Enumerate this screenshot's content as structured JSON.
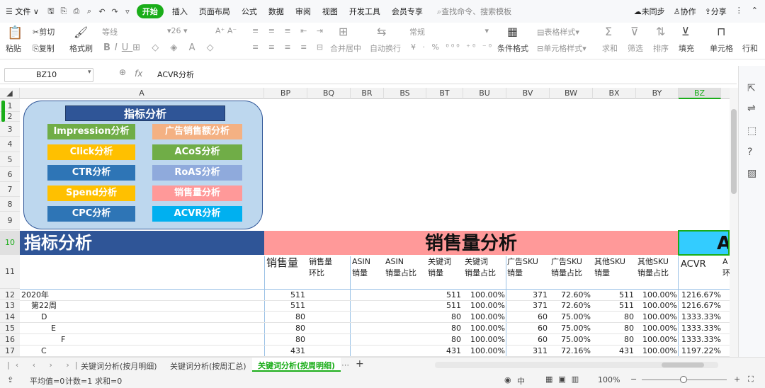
{
  "menu": {
    "file": "文件",
    "start": "开始",
    "items": [
      "插入",
      "页面布局",
      "公式",
      "数据",
      "审阅",
      "视图",
      "开发工具",
      "会员专享"
    ],
    "search": "查找命令、搜索模板",
    "unsync": "未同步",
    "collab": "协作",
    "share": "分享"
  },
  "ribbon": {
    "paste": "粘贴",
    "cut": "剪切",
    "copy": "复制",
    "format_painter": "格式刷",
    "font": "等线",
    "size": "26",
    "merge": "合并居中",
    "wrap": "自动换行",
    "numfmt": "常规",
    "cond_fmt": "条件格式",
    "table_style": "表格样式",
    "cell_style": "单元格样式",
    "sum": "求和",
    "filter": "筛选",
    "sort": "排序",
    "fill": "填充",
    "cell": "单元格",
    "rowcol": "行和"
  },
  "formula_bar": {
    "name_box": "BZ10",
    "fx": "fx",
    "content": "ACVR分析"
  },
  "columns": [
    "A",
    "BP",
    "BQ",
    "BR",
    "BS",
    "BT",
    "BU",
    "BV",
    "BW",
    "BX",
    "BY",
    "BZ"
  ],
  "rows": [
    "1",
    "2",
    "3",
    "4",
    "5",
    "6",
    "7",
    "8",
    "9",
    "10",
    "11",
    "12",
    "13",
    "14",
    "15",
    "16",
    "17"
  ],
  "panel": {
    "title": "指标分析",
    "buttons": [
      {
        "label": "Impression分析",
        "color": "#70ad47"
      },
      {
        "label": "广告销售额分析",
        "color": "#f4b183"
      },
      {
        "label": "Click分析",
        "color": "#ffc000"
      },
      {
        "label": "ACoS分析",
        "color": "#70ad47"
      },
      {
        "label": "CTR分析",
        "color": "#2e75b6"
      },
      {
        "label": "RoAS分析",
        "color": "#8faadc"
      },
      {
        "label": "Spend分析",
        "color": "#ffc000"
      },
      {
        "label": "销售量分析",
        "color": "#ff9999"
      },
      {
        "label": "CPC分析",
        "color": "#2e75b6"
      },
      {
        "label": "ACVR分析",
        "color": "#00b0f0"
      }
    ]
  },
  "bands": {
    "a": "指标分析",
    "b": "销售量分析",
    "c": "A"
  },
  "headers": {
    "h1": "销售量",
    "h2a": "销售量",
    "h2b": "环比",
    "h3a": "ASIN",
    "h3b": "销量",
    "h4a": "ASIN",
    "h4b": "销量占比",
    "h5a": "关键词",
    "h5b": "销量",
    "h6a": "关键词",
    "h6b": "销量占比",
    "h7a": "广告SKU",
    "h7b": "销量",
    "h8a": "广告SKU",
    "h8b": "销量占比",
    "h9a": "其他SKU",
    "h9b": "销量",
    "h10a": "其他SKU",
    "h10b": "销量占比",
    "h11": "ACVR",
    "h12a": "A",
    "h12b": "环"
  },
  "table": [
    {
      "label": "2020年",
      "v": [
        "511",
        "511",
        "100.00%",
        "371",
        "72.60%",
        "511",
        "100.00%",
        "1216.67%"
      ]
    },
    {
      "label": "第22周",
      "v": [
        "511",
        "511",
        "100.00%",
        "371",
        "72.60%",
        "511",
        "100.00%",
        "1216.67%"
      ]
    },
    {
      "label": "D",
      "v": [
        "80",
        "80",
        "100.00%",
        "60",
        "75.00%",
        "80",
        "100.00%",
        "1333.33%"
      ]
    },
    {
      "label": "E",
      "v": [
        "80",
        "80",
        "100.00%",
        "60",
        "75.00%",
        "80",
        "100.00%",
        "1333.33%"
      ]
    },
    {
      "label": "F",
      "v": [
        "80",
        "80",
        "100.00%",
        "60",
        "75.00%",
        "80",
        "100.00%",
        "1333.33%"
      ]
    },
    {
      "label": "C",
      "v": [
        "431",
        "431",
        "100.00%",
        "311",
        "72.16%",
        "431",
        "100.00%",
        "1197.22%"
      ]
    }
  ],
  "tabs": [
    "关键词分析(按月明细)",
    "关键词分析(按周汇总)",
    "关键词分析(按周明细)"
  ],
  "status": {
    "avg": "平均值=0",
    "count": "计数=1",
    "sum": "求和=0",
    "zoom": "100%",
    "ime": "中"
  }
}
